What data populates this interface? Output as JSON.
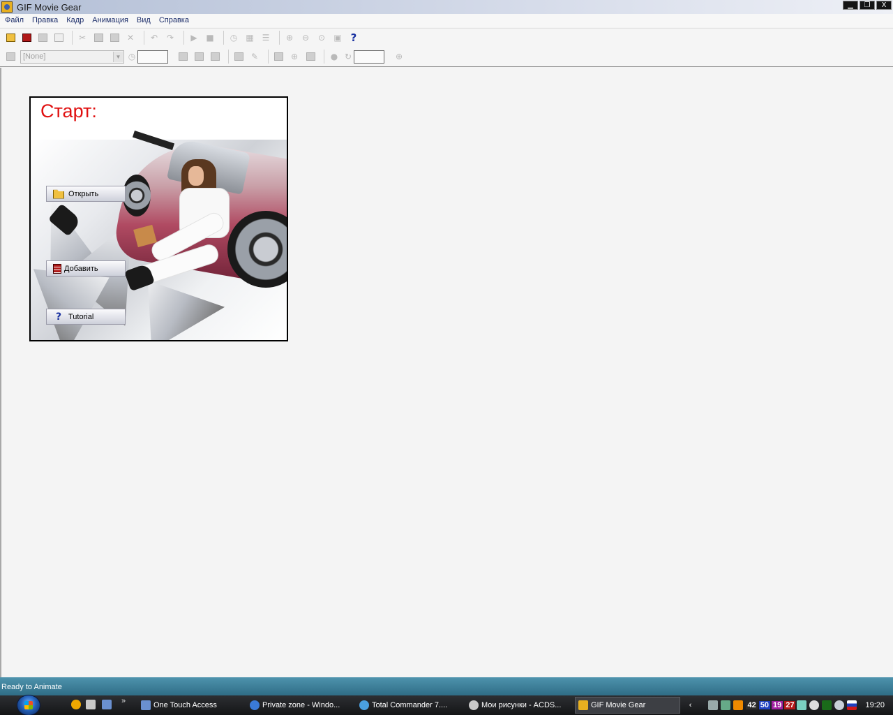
{
  "window": {
    "title": "GIF Movie Gear",
    "controls": {
      "minimize": "▁",
      "maximize": "❐",
      "close": "X"
    }
  },
  "menu": [
    "Файл",
    "Правка",
    "Кадр",
    "Анимация",
    "Вид",
    "Справка"
  ],
  "toolbar2": {
    "combo_value": "[None]"
  },
  "start_panel": {
    "title": "Старт:",
    "buttons": {
      "open": "Открыть",
      "add": "Добавить",
      "tutorial": "Tutorial"
    }
  },
  "statusbar": {
    "text": "Ready to Animate"
  },
  "taskbar": {
    "more": "»",
    "tasks": [
      {
        "label": "One Touch Access",
        "color": "#6a90d0"
      },
      {
        "label": "Private zone - Windo...",
        "color": "#3a7ad8"
      },
      {
        "label": "Total Commander 7....",
        "color": "#4aa0e0"
      },
      {
        "label": "Мои рисунки - ACDS...",
        "color": "#c8c8c8"
      },
      {
        "label": "GIF Movie Gear",
        "color": "#e8b020"
      }
    ],
    "tray": {
      "arrow": "‹",
      "numbers": [
        {
          "value": "42",
          "bg": "#2a2a2a"
        },
        {
          "value": "50",
          "bg": "#2040c0"
        },
        {
          "value": "19",
          "bg": "#a020a0"
        },
        {
          "value": "27",
          "bg": "#b01818"
        }
      ],
      "clock": "19:20"
    }
  }
}
